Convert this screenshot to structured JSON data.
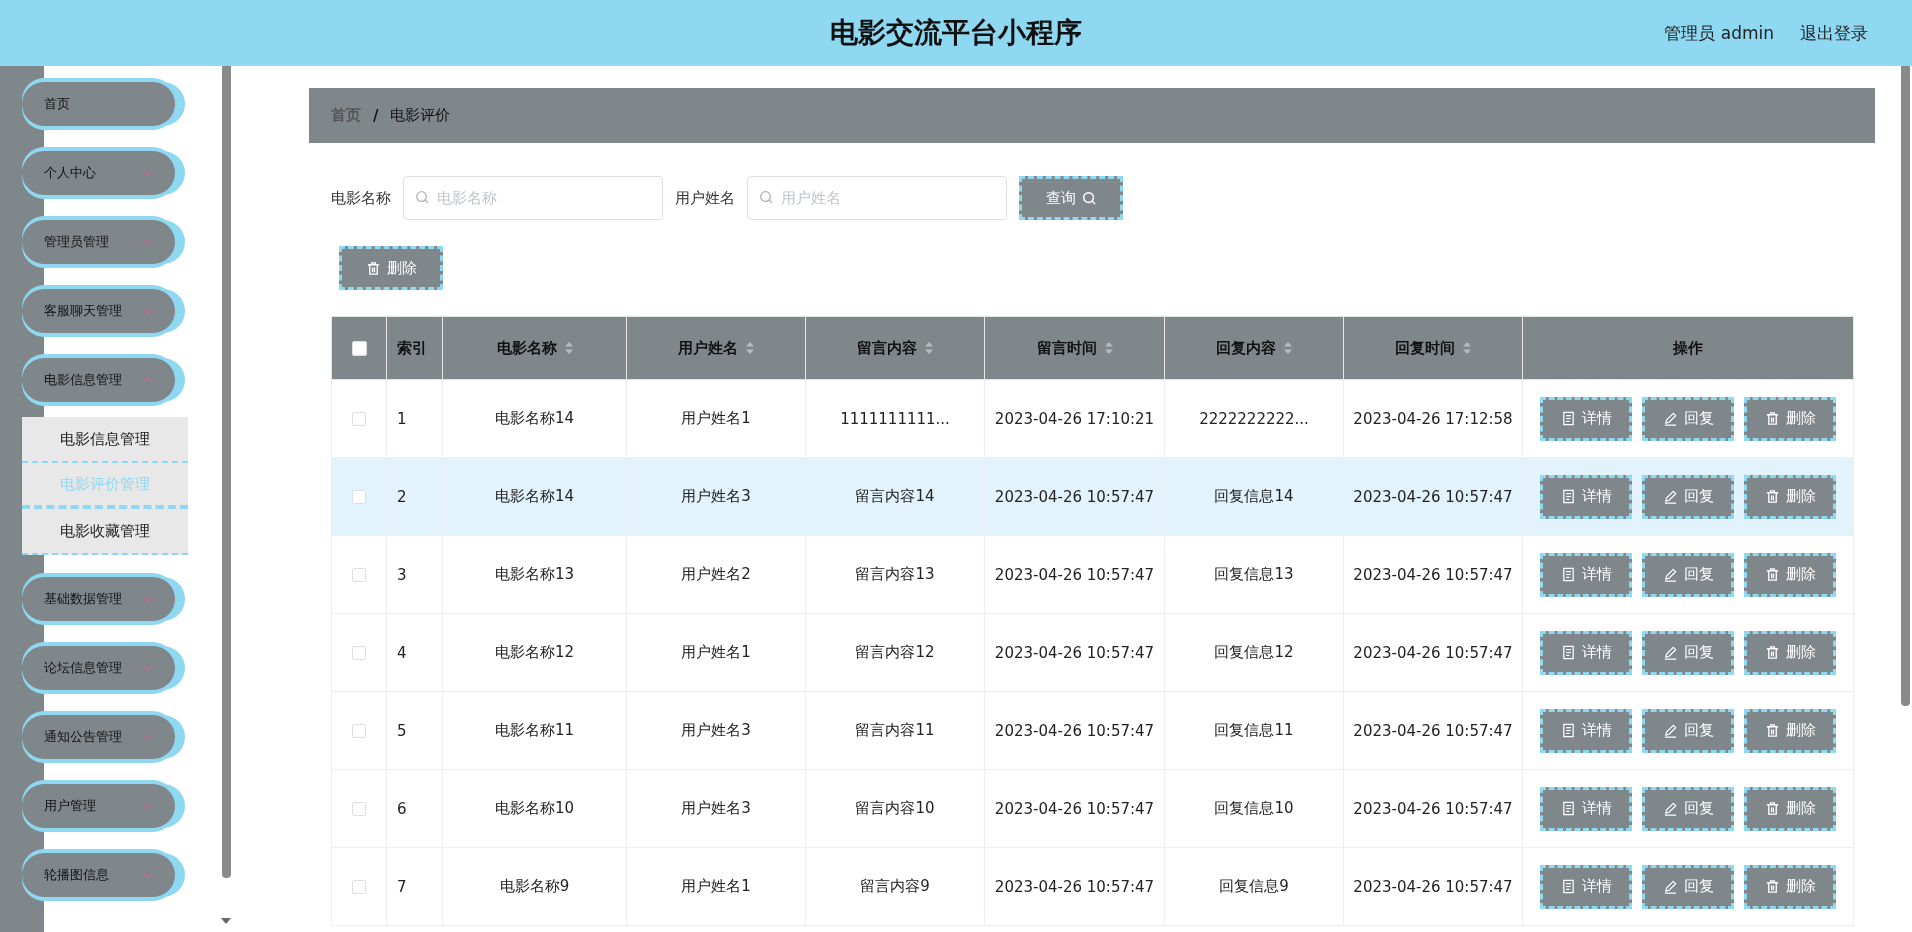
{
  "header": {
    "title": "电影交流平台小程序",
    "user": "管理员 admin",
    "logout": "退出登录"
  },
  "sidebar": {
    "items": [
      {
        "label": "首页",
        "expandable": false
      },
      {
        "label": "个人中心",
        "expandable": true,
        "expanded": false
      },
      {
        "label": "管理员管理",
        "expandable": true,
        "expanded": false
      },
      {
        "label": "客服聊天管理",
        "expandable": true,
        "expanded": false
      },
      {
        "label": "电影信息管理",
        "expandable": true,
        "expanded": true,
        "children": [
          {
            "label": "电影信息管理",
            "selected": false
          },
          {
            "label": "电影评价管理",
            "selected": true
          },
          {
            "label": "电影收藏管理",
            "selected": false
          }
        ]
      },
      {
        "label": "基础数据管理",
        "expandable": true,
        "expanded": false
      },
      {
        "label": "论坛信息管理",
        "expandable": true,
        "expanded": false
      },
      {
        "label": "通知公告管理",
        "expandable": true,
        "expanded": false
      },
      {
        "label": "用户管理",
        "expandable": true,
        "expanded": false
      },
      {
        "label": "轮播图信息",
        "expandable": true,
        "expanded": false
      }
    ]
  },
  "breadcrumb": [
    {
      "label": "首页",
      "current": false
    },
    {
      "label": "电影评价",
      "current": true
    }
  ],
  "breadcrumb_separator": "/",
  "search": {
    "fields": [
      {
        "label": "电影名称",
        "placeholder": "电影名称"
      },
      {
        "label": "用户姓名",
        "placeholder": "用户姓名"
      }
    ],
    "button": "查询"
  },
  "toolbar": {
    "delete_button": "删除"
  },
  "table": {
    "select_all_checked": false,
    "columns": [
      {
        "label": "索引",
        "sortable": false
      },
      {
        "label": "电影名称",
        "sortable": true
      },
      {
        "label": "用户姓名",
        "sortable": true
      },
      {
        "label": "留言内容",
        "sortable": true
      },
      {
        "label": "留言时间",
        "sortable": true
      },
      {
        "label": "回复内容",
        "sortable": true
      },
      {
        "label": "回复时间",
        "sortable": true
      },
      {
        "label": "操作",
        "sortable": false
      }
    ],
    "rows": [
      {
        "checked": false,
        "highlighted": false,
        "cells": [
          "1",
          "电影名称14",
          "用户姓名1",
          "1111111111...",
          "2023-04-26 17:10:21",
          "2222222222...",
          "2023-04-26 17:12:58"
        ],
        "actions": [
          {
            "kind": "detail",
            "label": "详情"
          },
          {
            "kind": "reply",
            "label": "回复"
          },
          {
            "kind": "delete",
            "label": "删除"
          }
        ]
      },
      {
        "checked": false,
        "highlighted": true,
        "cells": [
          "2",
          "电影名称14",
          "用户姓名3",
          "留言内容14",
          "2023-04-26 10:57:47",
          "回复信息14",
          "2023-04-26 10:57:47"
        ],
        "actions": [
          {
            "kind": "detail",
            "label": "详情"
          },
          {
            "kind": "reply",
            "label": "回复"
          },
          {
            "kind": "delete",
            "label": "删除"
          }
        ]
      },
      {
        "checked": false,
        "highlighted": false,
        "cells": [
          "3",
          "电影名称13",
          "用户姓名2",
          "留言内容13",
          "2023-04-26 10:57:47",
          "回复信息13",
          "2023-04-26 10:57:47"
        ],
        "actions": [
          {
            "kind": "detail",
            "label": "详情"
          },
          {
            "kind": "reply",
            "label": "回复"
          },
          {
            "kind": "delete",
            "label": "删除"
          }
        ]
      },
      {
        "checked": false,
        "highlighted": false,
        "cells": [
          "4",
          "电影名称12",
          "用户姓名1",
          "留言内容12",
          "2023-04-26 10:57:47",
          "回复信息12",
          "2023-04-26 10:57:47"
        ],
        "actions": [
          {
            "kind": "detail",
            "label": "详情"
          },
          {
            "kind": "reply",
            "label": "回复"
          },
          {
            "kind": "delete",
            "label": "删除"
          }
        ]
      },
      {
        "checked": false,
        "highlighted": false,
        "cells": [
          "5",
          "电影名称11",
          "用户姓名3",
          "留言内容11",
          "2023-04-26 10:57:47",
          "回复信息11",
          "2023-04-26 10:57:47"
        ],
        "actions": [
          {
            "kind": "detail",
            "label": "详情"
          },
          {
            "kind": "reply",
            "label": "回复"
          },
          {
            "kind": "delete",
            "label": "删除"
          }
        ]
      },
      {
        "checked": false,
        "highlighted": false,
        "cells": [
          "6",
          "电影名称10",
          "用户姓名3",
          "留言内容10",
          "2023-04-26 10:57:47",
          "回复信息10",
          "2023-04-26 10:57:47"
        ],
        "actions": [
          {
            "kind": "detail",
            "label": "详情"
          },
          {
            "kind": "reply",
            "label": "回复"
          },
          {
            "kind": "delete",
            "label": "删除"
          }
        ]
      },
      {
        "checked": false,
        "highlighted": false,
        "cells": [
          "7",
          "电影名称9",
          "用户姓名1",
          "留言内容9",
          "2023-04-26 10:57:47",
          "回复信息9",
          "2023-04-26 10:57:47"
        ],
        "actions": [
          {
            "kind": "detail",
            "label": "详情"
          },
          {
            "kind": "reply",
            "label": "回复"
          },
          {
            "kind": "delete",
            "label": "删除"
          }
        ]
      }
    ]
  }
}
